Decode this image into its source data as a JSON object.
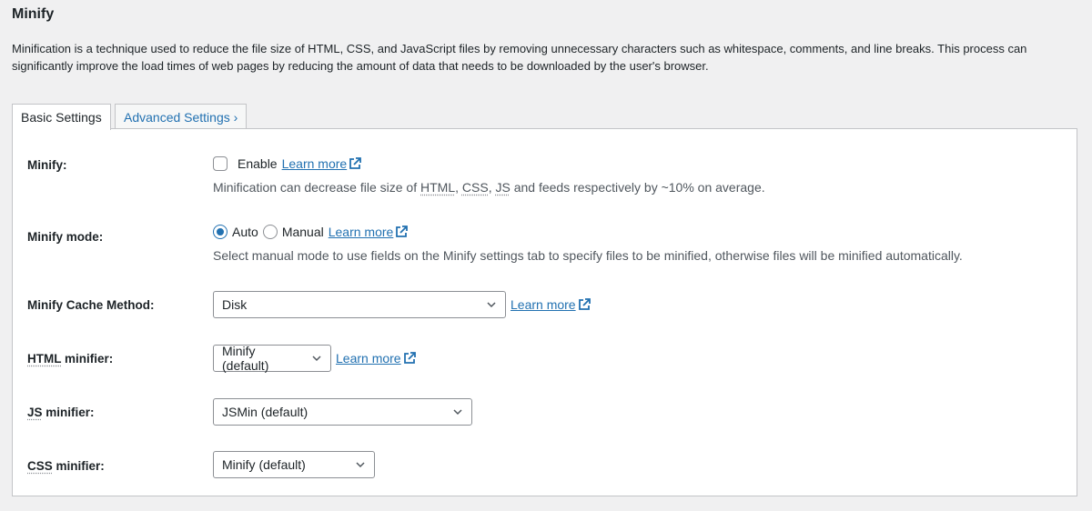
{
  "title": "Minify",
  "description": "Minification is a technique used to reduce the file size of HTML, CSS, and JavaScript files by removing unnecessary characters such as whitespace, comments, and line breaks. This process can significantly improve the load times of web pages by reducing the amount of data that needs to be downloaded by the user's browser.",
  "tabs": [
    {
      "label": "Basic Settings",
      "active": true
    },
    {
      "label": "Advanced Settings ›",
      "active": false
    }
  ],
  "link_color": "#2271b1",
  "settings": {
    "minify": {
      "label": "Minify:",
      "checkbox_label": "Enable",
      "checked": false,
      "learn_more": "Learn more",
      "help": [
        "Minification can decrease file size of ",
        "HTML",
        ", ",
        "CSS",
        ", ",
        "JS",
        " and feeds respectively by ~10% on average."
      ]
    },
    "mode": {
      "label": "Minify mode:",
      "options": [
        "Auto",
        "Manual"
      ],
      "selected": "Auto",
      "learn_more": "Learn more",
      "help": "Select manual mode to use fields on the Minify settings tab to specify files to be minified, otherwise files will be minified automatically."
    },
    "cache": {
      "label": "Minify Cache Method:",
      "value": "Disk",
      "learn_more": "Learn more"
    },
    "html": {
      "label_abbr": "HTML",
      "label_rest": " minifier:",
      "value": "Minify (default)",
      "learn_more": "Learn more"
    },
    "js": {
      "label_abbr": "JS",
      "label_rest": " minifier:",
      "value": "JSMin (default)"
    },
    "css": {
      "label_abbr": "CSS",
      "label_rest": " minifier:",
      "value": "Minify (default)"
    }
  }
}
